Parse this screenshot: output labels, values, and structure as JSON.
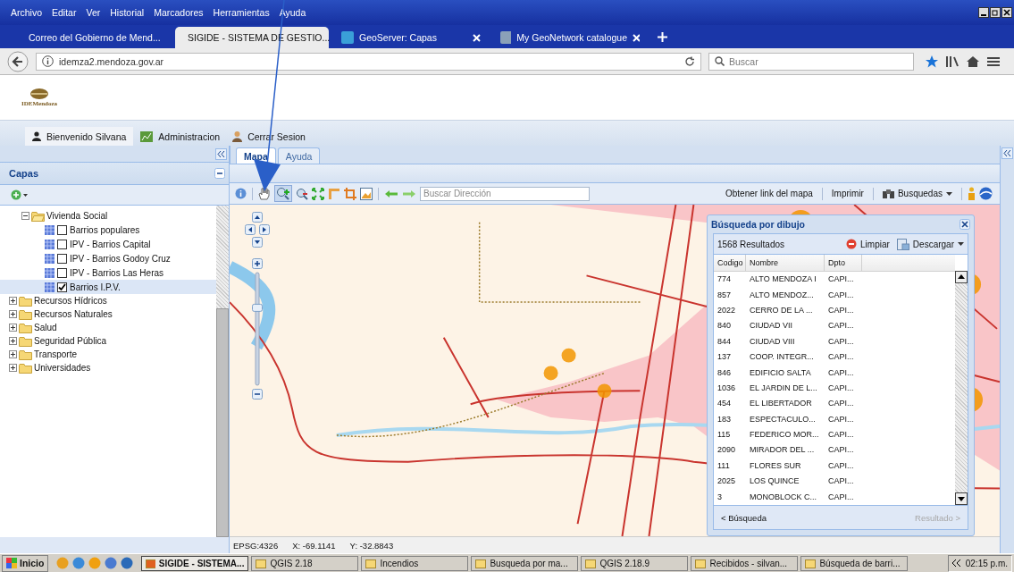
{
  "menu_bar": [
    "Archivo",
    "Editar",
    "Ver",
    "Historial",
    "Marcadores",
    "Herramientas",
    "Ayuda"
  ],
  "browser_tabs": [
    {
      "title": "Correo del Gobierno de Mend...",
      "selected": false
    },
    {
      "title": "SIGIDE - SISTEMA DE GESTIO...",
      "selected": true
    },
    {
      "title": "GeoServer: Capas",
      "selected": false
    },
    {
      "title": "My GeoNetwork catalogue",
      "selected": false
    }
  ],
  "address_bar": {
    "url": "idemza2.mendoza.gov.ar",
    "search_placeholder": "Buscar"
  },
  "site_header": {
    "logo_text": "IDEMendoza"
  },
  "session_bar": [
    "Bienvenido Silvana",
    "Administracion",
    "Cerrar Sesion"
  ],
  "layers_panel": {
    "title": "Capas",
    "tree": [
      {
        "label": "Vivienda Social",
        "expanded": true,
        "children": [
          {
            "label": "Barrios populares",
            "checked": false,
            "selected": false
          },
          {
            "label": "IPV - Barrios Capital",
            "checked": false,
            "selected": false
          },
          {
            "label": "IPV - Barrios Godoy Cruz",
            "checked": false,
            "selected": false
          },
          {
            "label": "IPV - Barrios Las Heras",
            "checked": false,
            "selected": false
          },
          {
            "label": "Barrios I.P.V.",
            "checked": true,
            "selected": true
          }
        ]
      },
      {
        "label": "Recursos Hídricos",
        "expanded": false
      },
      {
        "label": "Recursos Naturales",
        "expanded": false
      },
      {
        "label": "Salud",
        "expanded": false
      },
      {
        "label": "Seguridad Pública",
        "expanded": false
      },
      {
        "label": "Transporte",
        "expanded": false
      },
      {
        "label": "Universidades",
        "expanded": false
      }
    ]
  },
  "map_zoom": {
    "level": 0.7
  },
  "content_tabs": [
    {
      "label": "Mapa",
      "selected": true
    },
    {
      "label": "Ayuda",
      "selected": false
    }
  ],
  "map_toolbar": {
    "search_placeholder": "Buscar Dirección",
    "link": "Obtener link del mapa",
    "print": "Imprimir",
    "searches": "Busquedas"
  },
  "search_window": {
    "title": "Búsqueda por dibujo",
    "count": "1568 Resultados",
    "clear": "Limpiar",
    "download": "Descargar",
    "columns": [
      "Codigo",
      "Nombre",
      "Dpto"
    ],
    "rows": [
      [
        "774",
        "ALTO MENDOZA I",
        "CAPI..."
      ],
      [
        "857",
        "ALTO MENDOZ...",
        "CAPI..."
      ],
      [
        "2022",
        "CERRO DE LA ...",
        "CAPI..."
      ],
      [
        "840",
        "CIUDAD VII",
        "CAPI..."
      ],
      [
        "844",
        "CIUDAD VIII",
        "CAPI..."
      ],
      [
        "137",
        "COOP. INTEGR...",
        "CAPI..."
      ],
      [
        "846",
        "EDIFICIO SALTA",
        "CAPI..."
      ],
      [
        "1036",
        "EL JARDIN DE L...",
        "CAPI..."
      ],
      [
        "454",
        "EL LIBERTADOR",
        "CAPI..."
      ],
      [
        "183",
        "ESPECTACULO...",
        "CAPI..."
      ],
      [
        "115",
        "FEDERICO MOR...",
        "CAPI..."
      ],
      [
        "2090",
        "MIRADOR DEL ...",
        "CAPI..."
      ],
      [
        "111",
        "FLORES SUR",
        "CAPI..."
      ],
      [
        "2025",
        "LOS QUINCE",
        "CAPI..."
      ],
      [
        "3",
        "MONOBLOCK C...",
        "CAPI..."
      ]
    ],
    "back": "< Búsqueda",
    "next": "Resultado >"
  },
  "status_bar": [
    "EPSG:4326",
    "X: -69.1141",
    "Y: -32.8843"
  ],
  "taskbar": {
    "start": "Inicio",
    "items": [
      {
        "label": "SIGIDE - SISTEMA...",
        "selected": true
      },
      {
        "label": "QGIS 2.18",
        "selected": false
      },
      {
        "label": "Incendios",
        "selected": false
      },
      {
        "label": "Busqueda por ma...",
        "selected": false
      },
      {
        "label": "QGIS 2.18.9",
        "selected": false
      },
      {
        "label": "Recibidos - silvan...",
        "selected": false
      },
      {
        "label": "Búsqueda de barri...",
        "selected": false
      }
    ],
    "clock": "02:15 p.m."
  }
}
